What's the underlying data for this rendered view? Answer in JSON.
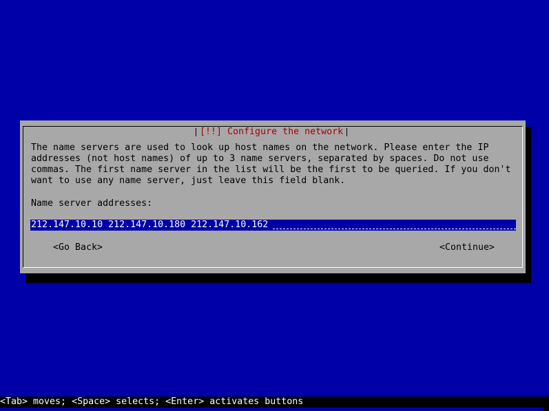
{
  "dialog": {
    "title": "[!!] Configure the network",
    "description": "The name servers are used to look up host names on the network. Please enter the IP\naddresses (not host names) of up to 3 name servers, separated by spaces. Do not use\ncommas. The first name server in the list will be the first to be queried. If you don't\nwant to use any name server, just leave this field blank.",
    "field_label": "Name server addresses:",
    "field_value": "212.147.10.10 212.147.10.180 212.147.10.162",
    "go_back_label": "<Go Back>",
    "continue_label": "<Continue>"
  },
  "statusbar": {
    "help": "<Tab> moves; <Space> selects; <Enter> activates buttons"
  },
  "colors": {
    "background": "#0000a8",
    "dialog": "#a8a8a8",
    "title": "#a80000",
    "field": "#0000a8"
  }
}
